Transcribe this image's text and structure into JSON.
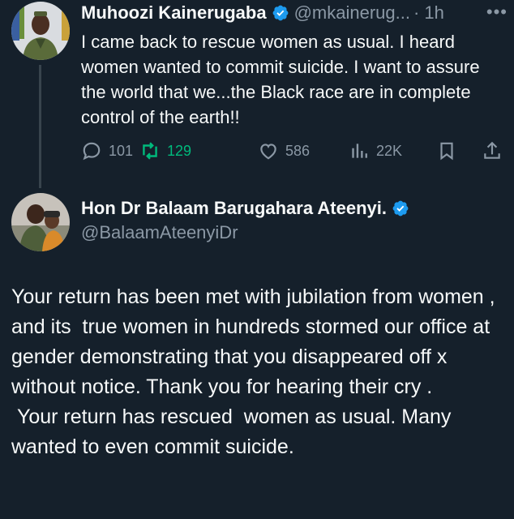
{
  "tweet1": {
    "display_name": "Muhoozi Kainerugaba",
    "handle": "@mkainerug...",
    "time": "· 1h",
    "more_label": "•••",
    "text": "I came back to rescue women as usual. I heard women wanted to commit suicide. I want to assure the world that we...the Black race are in complete control of the earth!!",
    "actions": {
      "replies": "101",
      "retweets": "129",
      "likes": "586",
      "views": "22K"
    }
  },
  "tweet2": {
    "display_name": "Hon Dr Balaam Barugahara Ateenyi.",
    "handle": "@BalaamAteenyiDr",
    "text": "Your return has been met with jubilation from women ,  and its  true women in hundreds stormed our office at gender demonstrating that you disappeared off x without notice. Thank you for hearing their cry .\n Your return has rescued  women as usual. Many wanted to even commit suicide."
  },
  "colors": {
    "background": "#15202b",
    "text": "#f7f9f9",
    "secondary": "#8b98a5",
    "verified": "#1d9bf0",
    "retweet_active": "#00ba7c",
    "thread_line": "#38444d"
  },
  "icons": {
    "verified": "verified-badge-icon",
    "reply": "reply-icon",
    "retweet": "retweet-icon",
    "like": "heart-icon",
    "views": "views-icon",
    "bookmark": "bookmark-icon",
    "share": "share-icon"
  }
}
